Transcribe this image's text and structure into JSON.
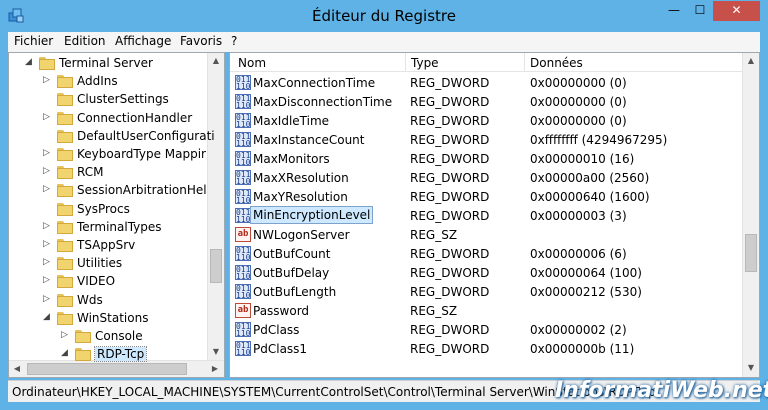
{
  "window": {
    "title": "Éditeur du Registre",
    "controls": {
      "minimize": "—",
      "maximize": "☐",
      "close": "✕"
    }
  },
  "menu": [
    "Fichier",
    "Edition",
    "Affichage",
    "Favoris",
    "?"
  ],
  "tree": {
    "items": [
      {
        "label": "Terminal Server",
        "expander": "◢",
        "level": 0
      },
      {
        "label": "AddIns",
        "expander": "▷",
        "level": 1
      },
      {
        "label": "ClusterSettings",
        "expander": "",
        "level": 1
      },
      {
        "label": "ConnectionHandler",
        "expander": "▷",
        "level": 1
      },
      {
        "label": "DefaultUserConfigurati",
        "expander": "",
        "level": 1
      },
      {
        "label": "KeyboardType Mappir",
        "expander": "▷",
        "level": 1
      },
      {
        "label": "RCM",
        "expander": "▷",
        "level": 1
      },
      {
        "label": "SessionArbitrationHel",
        "expander": "▷",
        "level": 1
      },
      {
        "label": "SysProcs",
        "expander": "",
        "level": 1
      },
      {
        "label": "TerminalTypes",
        "expander": "▷",
        "level": 1
      },
      {
        "label": "TSAppSrv",
        "expander": "▷",
        "level": 1
      },
      {
        "label": "Utilities",
        "expander": "▷",
        "level": 1
      },
      {
        "label": "VIDEO",
        "expander": "▷",
        "level": 1
      },
      {
        "label": "Wds",
        "expander": "▷",
        "level": 1
      },
      {
        "label": "WinStations",
        "expander": "◢",
        "level": 1
      },
      {
        "label": "Console",
        "expander": "▷",
        "level": 2
      },
      {
        "label": "RDP-Tcp",
        "expander": "◢",
        "level": 2,
        "selected": true
      }
    ]
  },
  "list": {
    "columns": {
      "name": "Nom",
      "type": "Type",
      "data": "Données"
    },
    "rows": [
      {
        "name": "MaxConnectionTime",
        "type": "REG_DWORD",
        "data": "0x00000000 (0)",
        "kind": "dword"
      },
      {
        "name": "MaxDisconnectionTime",
        "type": "REG_DWORD",
        "data": "0x00000000 (0)",
        "kind": "dword"
      },
      {
        "name": "MaxIdleTime",
        "type": "REG_DWORD",
        "data": "0x00000000 (0)",
        "kind": "dword"
      },
      {
        "name": "MaxInstanceCount",
        "type": "REG_DWORD",
        "data": "0xffffffff (4294967295)",
        "kind": "dword"
      },
      {
        "name": "MaxMonitors",
        "type": "REG_DWORD",
        "data": "0x00000010 (16)",
        "kind": "dword"
      },
      {
        "name": "MaxXResolution",
        "type": "REG_DWORD",
        "data": "0x00000a00 (2560)",
        "kind": "dword"
      },
      {
        "name": "MaxYResolution",
        "type": "REG_DWORD",
        "data": "0x00000640 (1600)",
        "kind": "dword"
      },
      {
        "name": "MinEncryptionLevel",
        "type": "REG_DWORD",
        "data": "0x00000003 (3)",
        "kind": "dword",
        "selected": true
      },
      {
        "name": "NWLogonServer",
        "type": "REG_SZ",
        "data": "",
        "kind": "sz"
      },
      {
        "name": "OutBufCount",
        "type": "REG_DWORD",
        "data": "0x00000006 (6)",
        "kind": "dword"
      },
      {
        "name": "OutBufDelay",
        "type": "REG_DWORD",
        "data": "0x00000064 (100)",
        "kind": "dword"
      },
      {
        "name": "OutBufLength",
        "type": "REG_DWORD",
        "data": "0x00000212 (530)",
        "kind": "dword"
      },
      {
        "name": "Password",
        "type": "REG_SZ",
        "data": "",
        "kind": "sz"
      },
      {
        "name": "PdClass",
        "type": "REG_DWORD",
        "data": "0x00000002 (2)",
        "kind": "dword"
      },
      {
        "name": "PdClass1",
        "type": "REG_DWORD",
        "data": "0x0000000b (11)",
        "kind": "dword"
      }
    ]
  },
  "icons": {
    "dword": "011\n110",
    "sz": "ab"
  },
  "status": "Ordinateur\\HKEY_LOCAL_MACHINE\\SYSTEM\\CurrentControlSet\\Control\\Terminal Server\\WinStations\\RDP-Tcp",
  "watermark": "InformatiWeb.net",
  "colors": {
    "frame": "#5fb2e6",
    "close": "#c7504a",
    "selection": "#cde8ff"
  }
}
